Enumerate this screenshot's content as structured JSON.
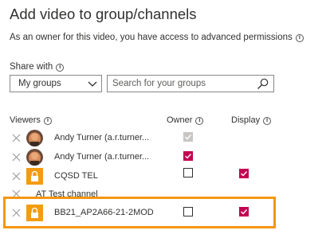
{
  "dialog": {
    "title": "Add video to group/channels",
    "subtitle": "As an owner for this video, you have access to advanced permissions"
  },
  "share": {
    "label": "Share with",
    "dropdown_value": "My groups",
    "search_placeholder": "Search for your groups"
  },
  "columns": {
    "viewers": "Viewers",
    "owner": "Owner",
    "display": "Display"
  },
  "rows": [
    {
      "name": "Andy Turner (a.r.turner...",
      "avatar": "person-photo",
      "owner": "checked-disabled",
      "display": "none"
    },
    {
      "name": "Andy Turner (a.r.turner...",
      "avatar": "person-photo",
      "owner": "checked",
      "display": "none"
    },
    {
      "name": "CQSD TEL",
      "avatar": "lock-icon",
      "owner": "unchecked",
      "display": "checked"
    },
    {
      "name": "AT Test channel",
      "avatar": "none",
      "owner": "none",
      "display": "none"
    },
    {
      "name": "BB21_AP2A66-21-2MOD",
      "avatar": "lock-icon",
      "owner": "unchecked",
      "display": "checked"
    }
  ],
  "colors": {
    "accent_checkbox": "#c30052",
    "lock_tile": "#f39c12",
    "highlight_border": "#f5960f",
    "text": "#323130"
  }
}
